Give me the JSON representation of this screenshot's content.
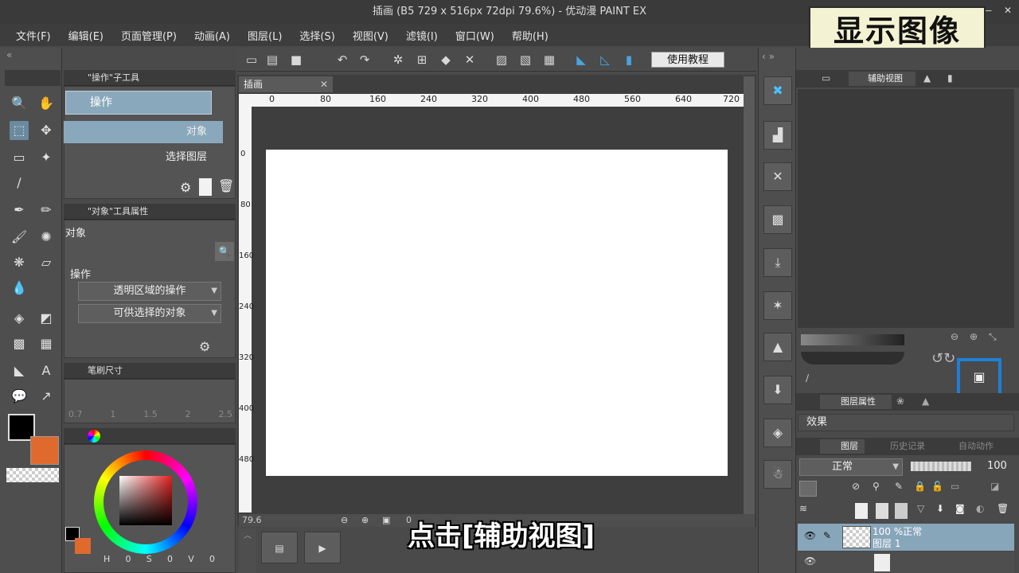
{
  "window": {
    "title": "插画 (B5 729 x 516px 72dpi 79.6%) - 优动漫 PAINT EX",
    "minimize": "—",
    "close": "✕"
  },
  "overlay_title": "显示图像",
  "subtitle": "点击[辅助视图]",
  "menu": [
    "文件(F)",
    "编辑(E)",
    "页面管理(P)",
    "动画(A)",
    "图层(L)",
    "选择(S)",
    "视图(V)",
    "滤镜(I)",
    "窗口(W)",
    "帮助(H)"
  ],
  "toolbar": {
    "tutorial_label": "使用教程"
  },
  "subtool_panel": {
    "header": "\"操作\"子工具",
    "selected": "操作",
    "items": [
      "对象",
      "选择图层"
    ]
  },
  "tool_property": {
    "header": "\"对象\"工具属性",
    "name": "对象",
    "section": "操作",
    "dropdown1": "透明区域的操作",
    "dropdown2": "可供选择的对象"
  },
  "brush_size": {
    "header": "笔刷尺寸",
    "sizes": [
      "0.7",
      "1",
      "1.5",
      "2",
      "2.5"
    ]
  },
  "color": {
    "main": "#000000",
    "sub": "#e06a2e",
    "hue_label_h": "H",
    "hue_s": "0",
    "label_s": "S",
    "hue_v": "0",
    "label_v": "V",
    "value_end": "0"
  },
  "canvas": {
    "tab_label": "插画",
    "tab_close": "✕",
    "ruler_h": [
      "0",
      "80",
      "160",
      "240",
      "320",
      "400",
      "480",
      "560",
      "640",
      "720"
    ],
    "ruler_v": [
      "0",
      "80",
      "160",
      "240",
      "320",
      "400",
      "480"
    ],
    "zoom": "79.6",
    "zoom_tail": "0"
  },
  "right_panel": {
    "tab_aux_view": "辅助视图",
    "layer_property_tab": "图层属性",
    "effect_label": "效果",
    "layer_tab": "图层",
    "history_tab": "历史记录",
    "auto_action_tab": "自动动作",
    "blend_mode": "正常",
    "opacity": "100",
    "layer1_line1": "100 %正常",
    "layer1_line2": "图层 1"
  }
}
